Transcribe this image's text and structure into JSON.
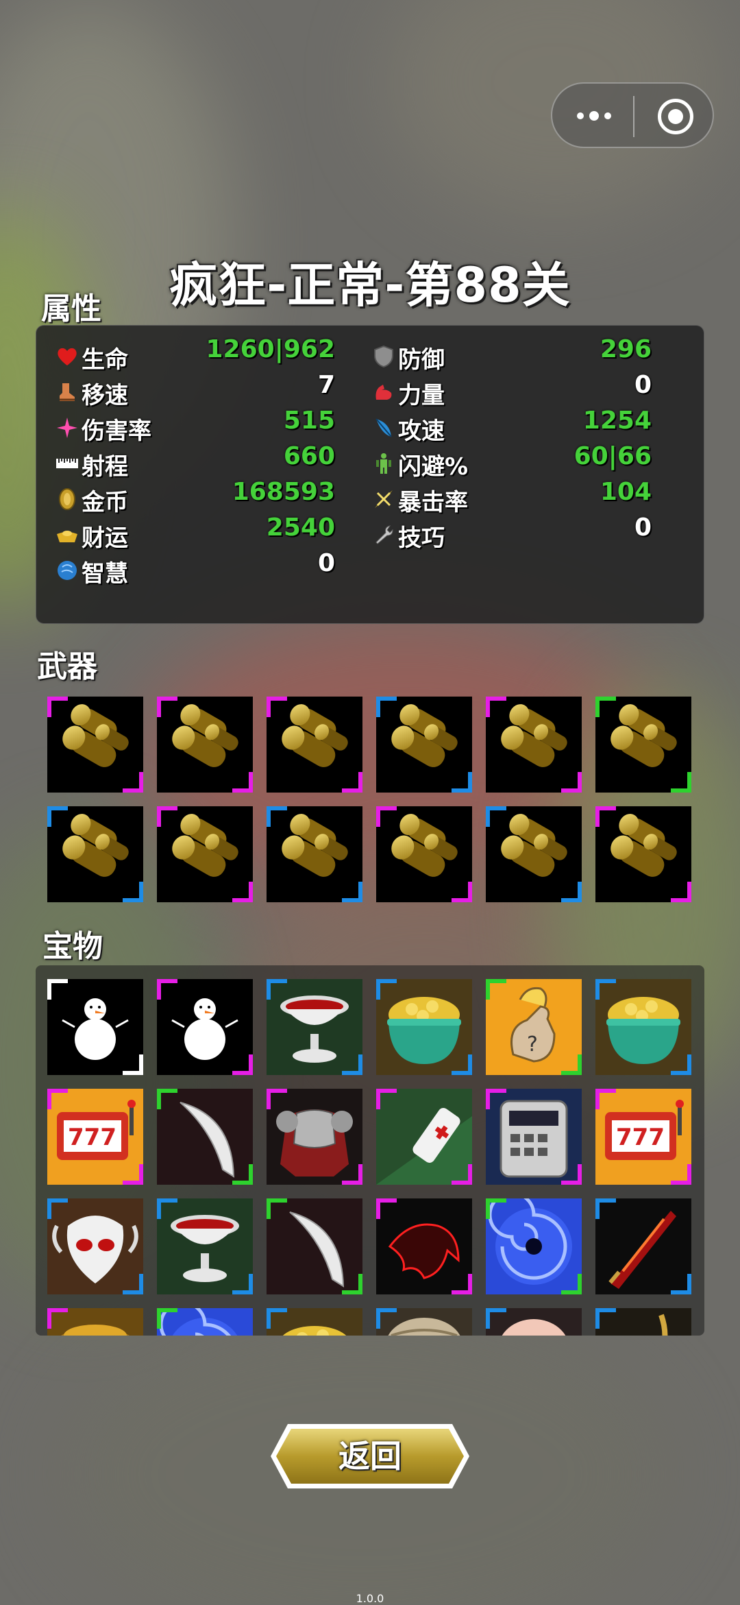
{
  "title": "疯狂-正常-第88关",
  "sections": {
    "attributes": "属性",
    "weapons": "武器",
    "treasures": "宝物"
  },
  "stats_left": [
    {
      "name": "生命",
      "value": "1260|962",
      "icon": "heart-icon",
      "color": "#45d23a"
    },
    {
      "name": "移速",
      "value": "7",
      "icon": "boot-icon",
      "color": "#ffffff"
    },
    {
      "name": "伤害率",
      "value": "515",
      "icon": "sparkle-icon",
      "color": "#45d23a"
    },
    {
      "name": "射程",
      "value": "660",
      "icon": "ruler-icon",
      "color": "#45d23a"
    },
    {
      "name": "金币",
      "value": "168593",
      "icon": "coin-icon",
      "color": "#45d23a"
    },
    {
      "name": "财运",
      "value": "2540",
      "icon": "gold-ingot-icon",
      "color": "#45d23a"
    },
    {
      "name": "智慧",
      "value": "0",
      "icon": "brain-icon",
      "color": "#ffffff"
    }
  ],
  "stats_right": [
    {
      "name": "防御",
      "value": "296",
      "icon": "shield-icon",
      "color": "#45d23a"
    },
    {
      "name": "力量",
      "value": "0",
      "icon": "muscle-icon",
      "color": "#ffffff"
    },
    {
      "name": "攻速",
      "value": "1254",
      "icon": "feather-icon",
      "color": "#45d23a"
    },
    {
      "name": "闪避%",
      "value": "60|66",
      "icon": "dodge-figure-icon",
      "color": "#45d23a"
    },
    {
      "name": "暴击率",
      "value": "104",
      "icon": "critical-star-icon",
      "color": "#45d23a"
    },
    {
      "name": "技巧",
      "value": "0",
      "icon": "wrench-icon",
      "color": "#ffffff"
    }
  ],
  "weapons": [
    {
      "item": "coin-stack-weapon",
      "rarity_color": "#e61ee6"
    },
    {
      "item": "coin-stack-weapon",
      "rarity_color": "#e61ee6"
    },
    {
      "item": "coin-stack-weapon",
      "rarity_color": "#e61ee6"
    },
    {
      "item": "coin-stack-weapon",
      "rarity_color": "#1e8ce6"
    },
    {
      "item": "coin-stack-weapon",
      "rarity_color": "#e61ee6"
    },
    {
      "item": "coin-stack-weapon",
      "rarity_color": "#2ed22e"
    },
    {
      "item": "coin-stack-weapon",
      "rarity_color": "#1e8ce6"
    },
    {
      "item": "coin-stack-weapon",
      "rarity_color": "#e61ee6"
    },
    {
      "item": "coin-stack-weapon",
      "rarity_color": "#1e8ce6"
    },
    {
      "item": "coin-stack-weapon",
      "rarity_color": "#e61ee6"
    },
    {
      "item": "coin-stack-weapon",
      "rarity_color": "#1e8ce6"
    },
    {
      "item": "coin-stack-weapon",
      "rarity_color": "#e61ee6"
    }
  ],
  "treasures": [
    {
      "item": "snowman",
      "rarity_color": "#ffffff"
    },
    {
      "item": "snowman",
      "rarity_color": "#e61ee6"
    },
    {
      "item": "bloody-goblet",
      "rarity_color": "#1e8ce6"
    },
    {
      "item": "gold-pot",
      "rarity_color": "#1e8ce6"
    },
    {
      "item": "hand-money-bag",
      "rarity_color": "#2ed22e"
    },
    {
      "item": "gold-pot",
      "rarity_color": "#1e8ce6"
    },
    {
      "item": "slot-777",
      "rarity_color": "#e61ee6"
    },
    {
      "item": "curved-blade",
      "rarity_color": "#2ed22e"
    },
    {
      "item": "armor",
      "rarity_color": "#e61ee6"
    },
    {
      "item": "medicine-spray",
      "rarity_color": "#e61ee6"
    },
    {
      "item": "calculator",
      "rarity_color": "#e61ee6"
    },
    {
      "item": "slot-777",
      "rarity_color": "#e61ee6"
    },
    {
      "item": "skull-mask",
      "rarity_color": "#1e8ce6"
    },
    {
      "item": "bloody-goblet",
      "rarity_color": "#1e8ce6"
    },
    {
      "item": "curved-blade",
      "rarity_color": "#2ed22e"
    },
    {
      "item": "red-claw",
      "rarity_color": "#e61ee6"
    },
    {
      "item": "vortex",
      "rarity_color": "#2ed22e"
    },
    {
      "item": "flame-sword",
      "rarity_color": "#1e8ce6"
    },
    {
      "item": "honey-pot",
      "rarity_color": "#e61ee6"
    },
    {
      "item": "vortex",
      "rarity_color": "#2ed22e"
    },
    {
      "item": "gold-pot",
      "rarity_color": "#1e8ce6"
    },
    {
      "item": "sack",
      "rarity_color": "#1e8ce6"
    },
    {
      "item": "piggy",
      "rarity_color": "#1e8ce6"
    },
    {
      "item": "rope",
      "rarity_color": "#1e8ce6"
    }
  ],
  "back_button": "返回",
  "version": "1.0.0",
  "capsule": {
    "menu_icon": "more-dots-icon",
    "close_icon": "target-close-icon"
  }
}
